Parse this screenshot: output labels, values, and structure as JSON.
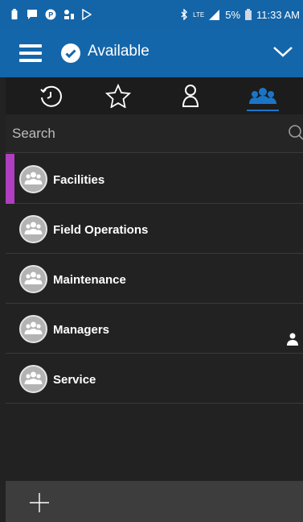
{
  "status_bar": {
    "time": "11:33 AM",
    "battery_percent": "5%",
    "network": "LTE",
    "left_icons": [
      "battery-low-icon",
      "message-icon",
      "parking-icon",
      "notification-icon",
      "play-store-icon"
    ],
    "right_icons": [
      "bluetooth-icon",
      "signal-icon",
      "battery-icon"
    ]
  },
  "header": {
    "status_label": "Available",
    "status_color": "#1466aa"
  },
  "tabs": [
    {
      "name": "recent",
      "icon": "history-icon",
      "active": false
    },
    {
      "name": "favorites",
      "icon": "star-icon",
      "active": false
    },
    {
      "name": "contacts",
      "icon": "person-icon",
      "active": false
    },
    {
      "name": "groups",
      "icon": "groups-icon",
      "active": true
    }
  ],
  "search": {
    "placeholder": "Search"
  },
  "groups": [
    {
      "label": "Facilities",
      "selected": true,
      "icon": "group-avatar-icon"
    },
    {
      "label": "Field Operations",
      "selected": false,
      "icon": "group-avatar-icon"
    },
    {
      "label": "Maintenance",
      "selected": false,
      "icon": "group-avatar-icon"
    },
    {
      "label": "Managers",
      "selected": false,
      "icon": "group-avatar-icon",
      "member_indicator": "person-icon"
    },
    {
      "label": "Service",
      "selected": false,
      "icon": "group-avatar-icon"
    }
  ],
  "footer": {
    "add_icon": "plus-icon"
  },
  "colors": {
    "accent_blue": "#1466aa",
    "selected_marker": "#b03ec0",
    "background": "#222222"
  }
}
